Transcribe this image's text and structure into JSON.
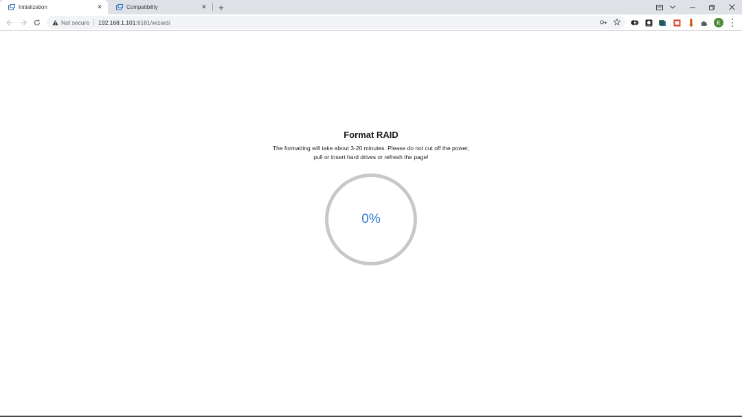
{
  "browser": {
    "tabs": [
      {
        "title": "Initialization",
        "active": true
      },
      {
        "title": "Compatibility",
        "active": false
      }
    ],
    "security_label": "Not secure",
    "url_host": "192.168.1.101",
    "url_path": ":8181/wizard/",
    "profile_initial": "K"
  },
  "wizard": {
    "title": "Format RAID",
    "description_line1": "The formatting will take about 3-20 minutes. Please do not cut off the power,",
    "description_line2": "pull or insert hard drives or refresh the page!",
    "progress_percent": 0,
    "progress_label": "0%"
  },
  "colors": {
    "progress_text": "#2b7ad6",
    "ring_track": "#c8c8c8",
    "tab_strip": "#dee1e6"
  }
}
